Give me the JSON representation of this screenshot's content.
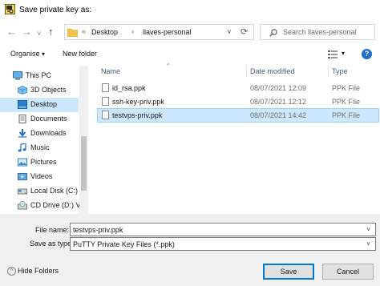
{
  "window": {
    "title": "Save private key as:",
    "title_icon": "putty-key-icon"
  },
  "nav": {
    "back_icon": "←",
    "forward_icon": "→",
    "recent_icon": "∨",
    "up_icon": "↑",
    "breadcrumb": {
      "overflow": "«",
      "segments": [
        "Desktop",
        "llaves-personal"
      ],
      "separator": "›"
    },
    "dropdown_icon": "∨",
    "refresh_icon": "⟳",
    "search_placeholder": "Search llaves-personal"
  },
  "toolbar": {
    "organise_label": "Organise",
    "organise_arrow": "▾",
    "new_folder_label": "New folder",
    "view_arrow": "▾",
    "help_icon": "?"
  },
  "sidebar": {
    "items": [
      {
        "label": "This PC",
        "icon": "computer-icon",
        "selected": false
      },
      {
        "label": "3D Objects",
        "icon": "3d-objects-icon",
        "selected": false
      },
      {
        "label": "Desktop",
        "icon": "desktop-icon",
        "selected": true
      },
      {
        "label": "Documents",
        "icon": "documents-icon",
        "selected": false
      },
      {
        "label": "Downloads",
        "icon": "downloads-icon",
        "selected": false
      },
      {
        "label": "Music",
        "icon": "music-icon",
        "selected": false
      },
      {
        "label": "Pictures",
        "icon": "pictures-icon",
        "selected": false
      },
      {
        "label": "Videos",
        "icon": "videos-icon",
        "selected": false
      },
      {
        "label": "Local Disk (C:)",
        "icon": "local-disk-icon",
        "selected": false
      },
      {
        "label": "CD Drive (D:) Vir",
        "icon": "cd-drive-icon",
        "selected": false
      }
    ]
  },
  "files": {
    "columns": [
      "Name",
      "Date modified",
      "Type"
    ],
    "sort_indicator": "^",
    "rows": [
      {
        "name": "id_rsa.ppk",
        "date": "08/07/2021 12:09",
        "type": "PPK File",
        "selected": false
      },
      {
        "name": "ssh-key-priv.ppk",
        "date": "08/07/2021 12:12",
        "type": "PPK File",
        "selected": false
      },
      {
        "name": "testvps-priv.ppk",
        "date": "08/07/2021 14:42",
        "type": "PPK File",
        "selected": true
      }
    ]
  },
  "form": {
    "filename_label": "File name:",
    "filename_value": "testvps-priv.ppk",
    "savetype_label": "Save as type:",
    "savetype_value": "PuTTY Private Key Files (*.ppk)"
  },
  "footer": {
    "hide_folders_label": "Hide Folders",
    "hide_folders_icon": "^",
    "save_label": "Save",
    "cancel_label": "Cancel"
  },
  "colors": {
    "selection": "#cce8ff",
    "accent": "#0078d7",
    "folder": "#f3c44a"
  }
}
